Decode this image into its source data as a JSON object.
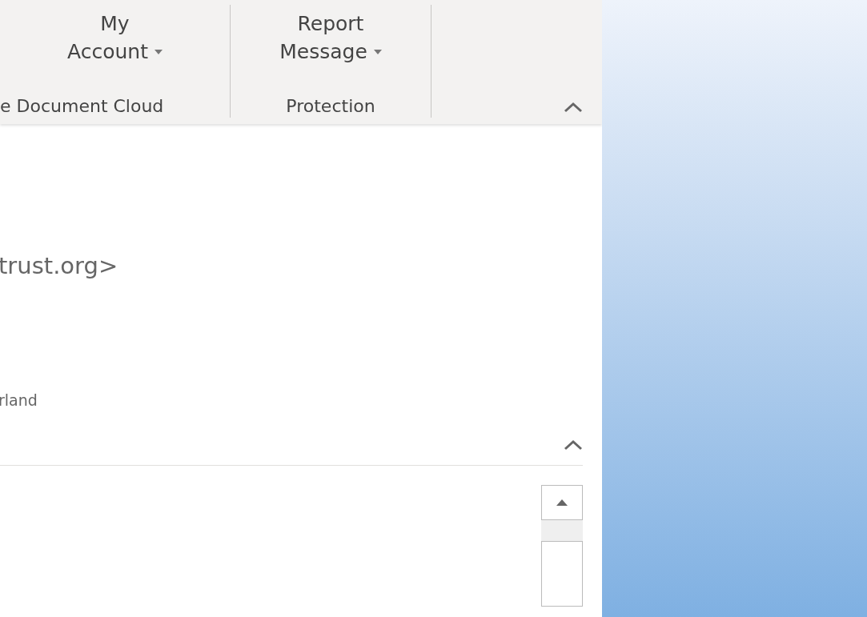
{
  "ribbon": {
    "groups": [
      {
        "label": "e Document Cloud",
        "button": {
          "lines": [
            "My",
            "Account"
          ],
          "dropdown": true
        }
      },
      {
        "label": "Protection",
        "button": {
          "lines": [
            "Report",
            "Message"
          ],
          "dropdown": true
        }
      }
    ],
    "collapse": {
      "expanded": true
    }
  },
  "message": {
    "sender": "trust.org>",
    "location": "rland",
    "section": {
      "expanded": true
    }
  }
}
